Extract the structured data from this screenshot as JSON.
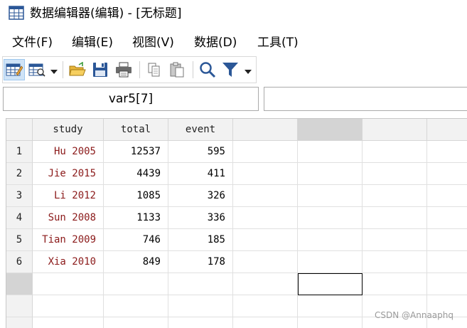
{
  "window": {
    "title": "数据编辑器(编辑) - [无标题]"
  },
  "menu": [
    {
      "label": "文件(F)"
    },
    {
      "label": "编辑(E)"
    },
    {
      "label": "视图(V)"
    },
    {
      "label": "数据(D)"
    },
    {
      "label": "工具(T)"
    }
  ],
  "toolbar": {
    "buttons": [
      "data-editor-edit-icon",
      "data-editor-browse-icon",
      "open-folder-icon",
      "save-icon",
      "print-icon",
      "copy-icon",
      "paste-icon",
      "search-icon",
      "filter-icon"
    ]
  },
  "namebox": {
    "value": "var5[7]"
  },
  "valuebox": {
    "value": ""
  },
  "grid": {
    "columns": [
      "study",
      "total",
      "event",
      "",
      "",
      ""
    ],
    "selected_column_index": 4,
    "rows": [
      {
        "n": "1",
        "study": "Hu 2005",
        "total": "12537",
        "event": "595"
      },
      {
        "n": "2",
        "study": "Jie 2015",
        "total": "4439",
        "event": "411"
      },
      {
        "n": "3",
        "study": "Li 2012",
        "total": "1085",
        "event": "326"
      },
      {
        "n": "4",
        "study": "Sun 2008",
        "total": "1133",
        "event": "336"
      },
      {
        "n": "5",
        "study": "Tian 2009",
        "total": "746",
        "event": "185"
      },
      {
        "n": "6",
        "study": "Xia 2010",
        "total": "849",
        "event": "178"
      }
    ],
    "selected_row": 7,
    "colors": {
      "string_text": "#8b1a1a",
      "header_bg": "#f2f2f2",
      "selected_header_bg": "#d4d4d4"
    }
  },
  "watermark": "CSDN @Annaaphq"
}
